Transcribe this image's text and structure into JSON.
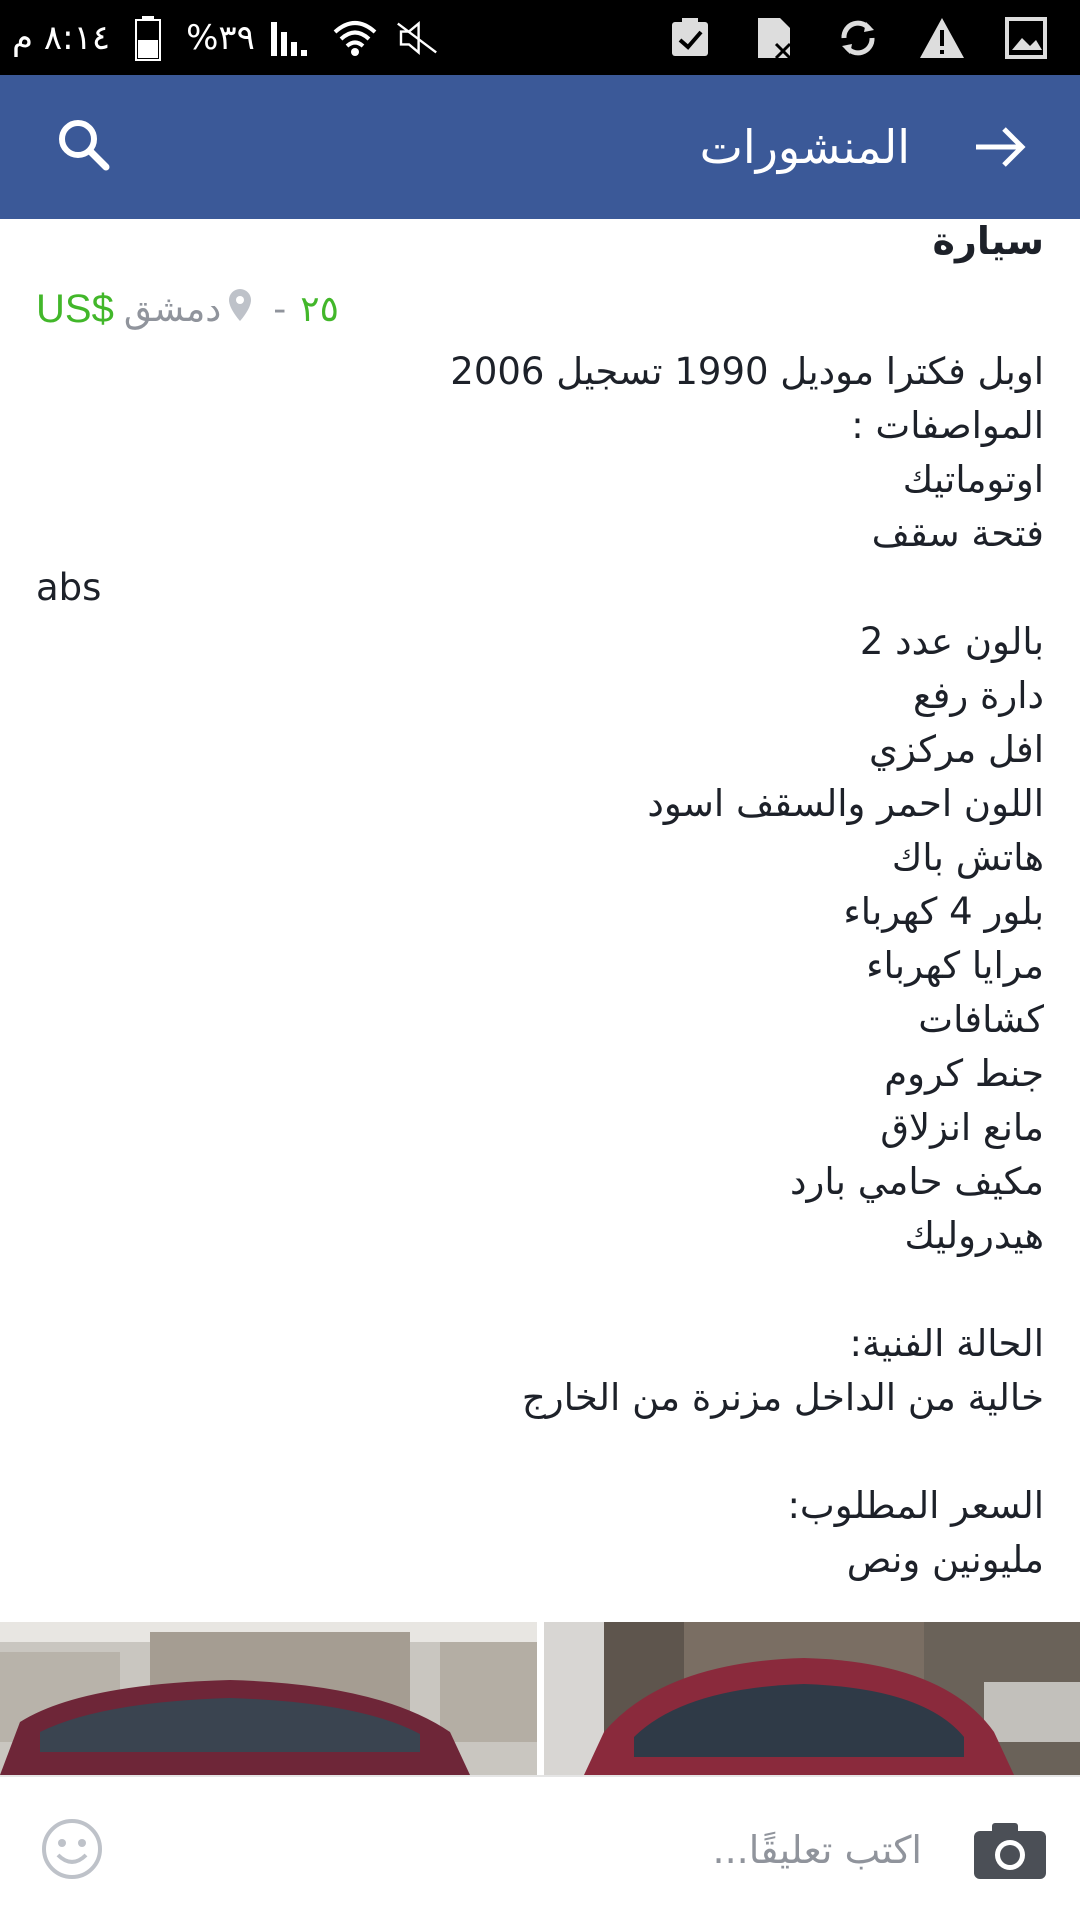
{
  "status_bar": {
    "time": "٨:١٤ م",
    "battery": "%٣٩",
    "icons": [
      "battery-icon",
      "signal-icon",
      "wifi-icon",
      "mute-icon",
      "clipboard-icon",
      "sim-icon",
      "sync-icon",
      "warning-icon",
      "gallery-icon"
    ]
  },
  "app_bar": {
    "title": "المنشورات",
    "back_icon": "arrow-right-icon",
    "search_icon": "search-icon"
  },
  "post": {
    "title": "سيارة",
    "price": "US$",
    "location": "دمشق",
    "separator": "-",
    "time": "٢٥",
    "lines": [
      "اوبل فكترا موديل 1990 تسجيل 2006",
      "المواصفات :",
      "اوتوماتيك",
      "فتحة سقف",
      "abs",
      "بالون عدد 2",
      "دارة رفع",
      "افل مركزي",
      "اللون احمر والسقف اسود",
      "هاتش باك",
      "بلور 4 كهرباء",
      "مرايا كهرباء",
      "كشافات",
      "جنط كروم",
      "مانع انزلاق",
      "مكيف حامي بارد",
      "هيدروليك",
      "",
      "الحالة الفنية:",
      "خالية من الداخل مزنرة من الخارج",
      "",
      "السعر المطلوب:",
      "مليونين ونص"
    ]
  },
  "comment_bar": {
    "placeholder": "اكتب تعليقًا...",
    "emoji_icon": "smiley-icon",
    "camera_icon": "camera-icon"
  },
  "colors": {
    "app_bar": "#3b5998",
    "price_green": "#42b72a",
    "meta_gray": "#90949c",
    "text": "#1d2129"
  }
}
